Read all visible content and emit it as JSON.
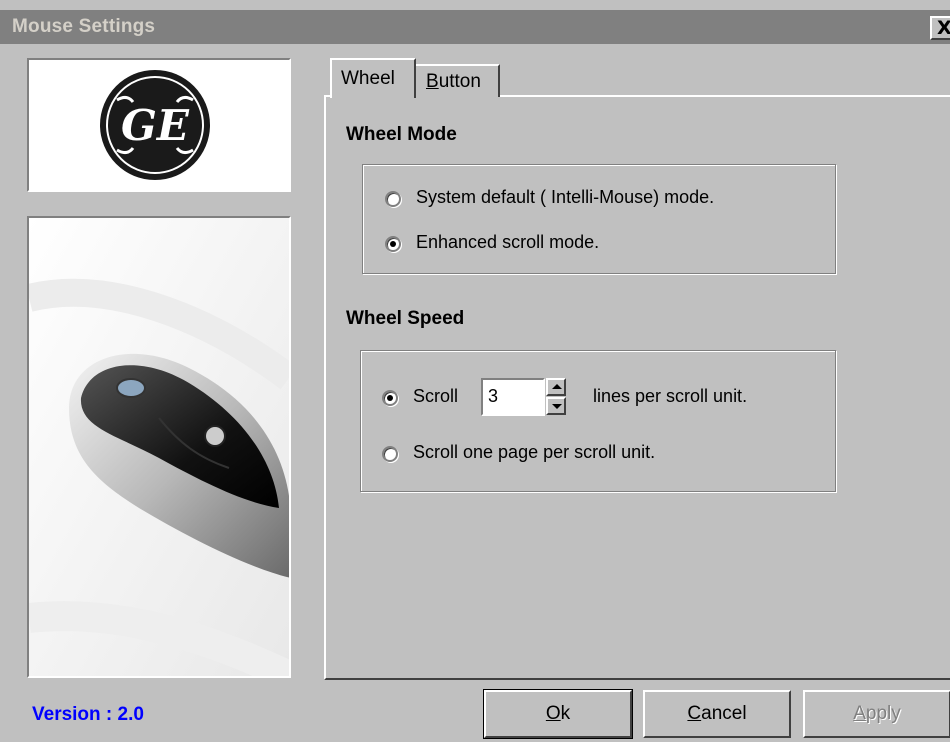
{
  "window": {
    "title": "Mouse Settings",
    "close_label": "X"
  },
  "logo": {
    "brand": "GE"
  },
  "tabs": [
    {
      "label": "Wheel",
      "accel": "",
      "selected": true
    },
    {
      "label_prefix": "",
      "accel": "B",
      "label_rest": "utton",
      "selected": false
    }
  ],
  "wheel_mode": {
    "title": "Wheel Mode",
    "options": [
      {
        "label": "System default ( Intelli-Mouse) mode.",
        "checked": false
      },
      {
        "label": "Enhanced scroll mode.",
        "checked": true
      }
    ]
  },
  "wheel_speed": {
    "title": "Wheel Speed",
    "scroll_label": "Scroll",
    "lines_value": "3",
    "lines_suffix": "lines per scroll unit.",
    "page_option": "Scroll one page per scroll unit.",
    "lines_checked": true,
    "page_checked": false
  },
  "footer": {
    "version": "Version : 2.0",
    "ok_accel": "O",
    "ok_rest": "k",
    "cancel_accel": "C",
    "cancel_rest": "ancel",
    "apply_accel": "A",
    "apply_rest": "pply"
  },
  "colors": {
    "face": "#c0c0c0",
    "title_bar": "#808080",
    "version_text": "#0000ff"
  }
}
